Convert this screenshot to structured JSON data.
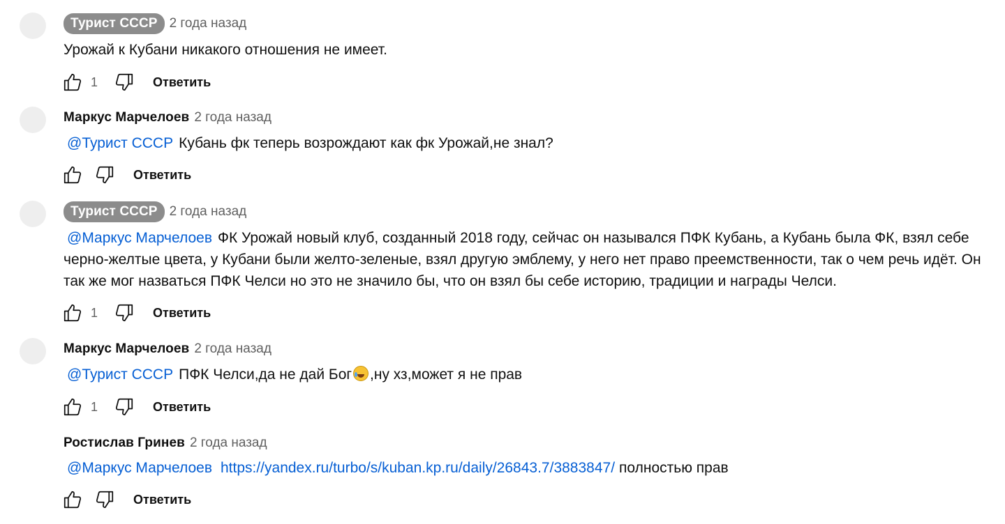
{
  "comments": [
    {
      "author": "Турист СССР",
      "time": "2 года назад",
      "text": "Урожай к Кубани никакого отношения не имеет.",
      "likes": "1",
      "reply": "Ответить"
    },
    {
      "author": "Маркус Марчелоев",
      "time": "2 года назад",
      "mention": "@Турист СССР",
      "text": "Кубань фк теперь возрождают как фк Урожай,не знал?",
      "reply": "Ответить"
    },
    {
      "author": "Турист СССР",
      "time": "2 года назад",
      "mention": "@Маркус Марчелоев",
      "text": "ФК Урожай новый клуб, созданный 2018 году, сейчас он назывался ПФК Кубань, а Кубань была ФК, взял себе черно-желтые цвета, у Кубани были желто-зеленые, взял другую эмблему, у него нет право преемственности, так о чем речь идёт. Он так же мог назваться ПФК Челси но это не значило бы, что он взял бы себе историю, традиции и награды Челси.",
      "likes": "1",
      "reply": "Ответить"
    },
    {
      "author": "Маркус Марчелоев",
      "time": "2 года назад",
      "mention": "@Турист СССР",
      "text_before": "ПФК Челси,да не дай Бог",
      "emoji": "face-with-tears-of-joy",
      "text_after": ",ну хз,может я не прав",
      "likes": "1",
      "reply": "Ответить"
    },
    {
      "author": "Ростислав Гринев",
      "time": "2 года назад",
      "mention": "@Маркус Марчелоев",
      "link": "https://yandex.ru/turbo/s/kuban.kp.ru/daily/26843.7/3883847/",
      "text": "полностью прав",
      "reply": "Ответить"
    }
  ],
  "colors": {
    "badge_bg": "#8c8c8c",
    "mention": "#065fd4",
    "meta_text": "#606060",
    "avatar": "#eeeeee"
  },
  "icons": {
    "like": "thumb-up-outline-icon",
    "dislike": "thumb-down-outline-icon"
  }
}
